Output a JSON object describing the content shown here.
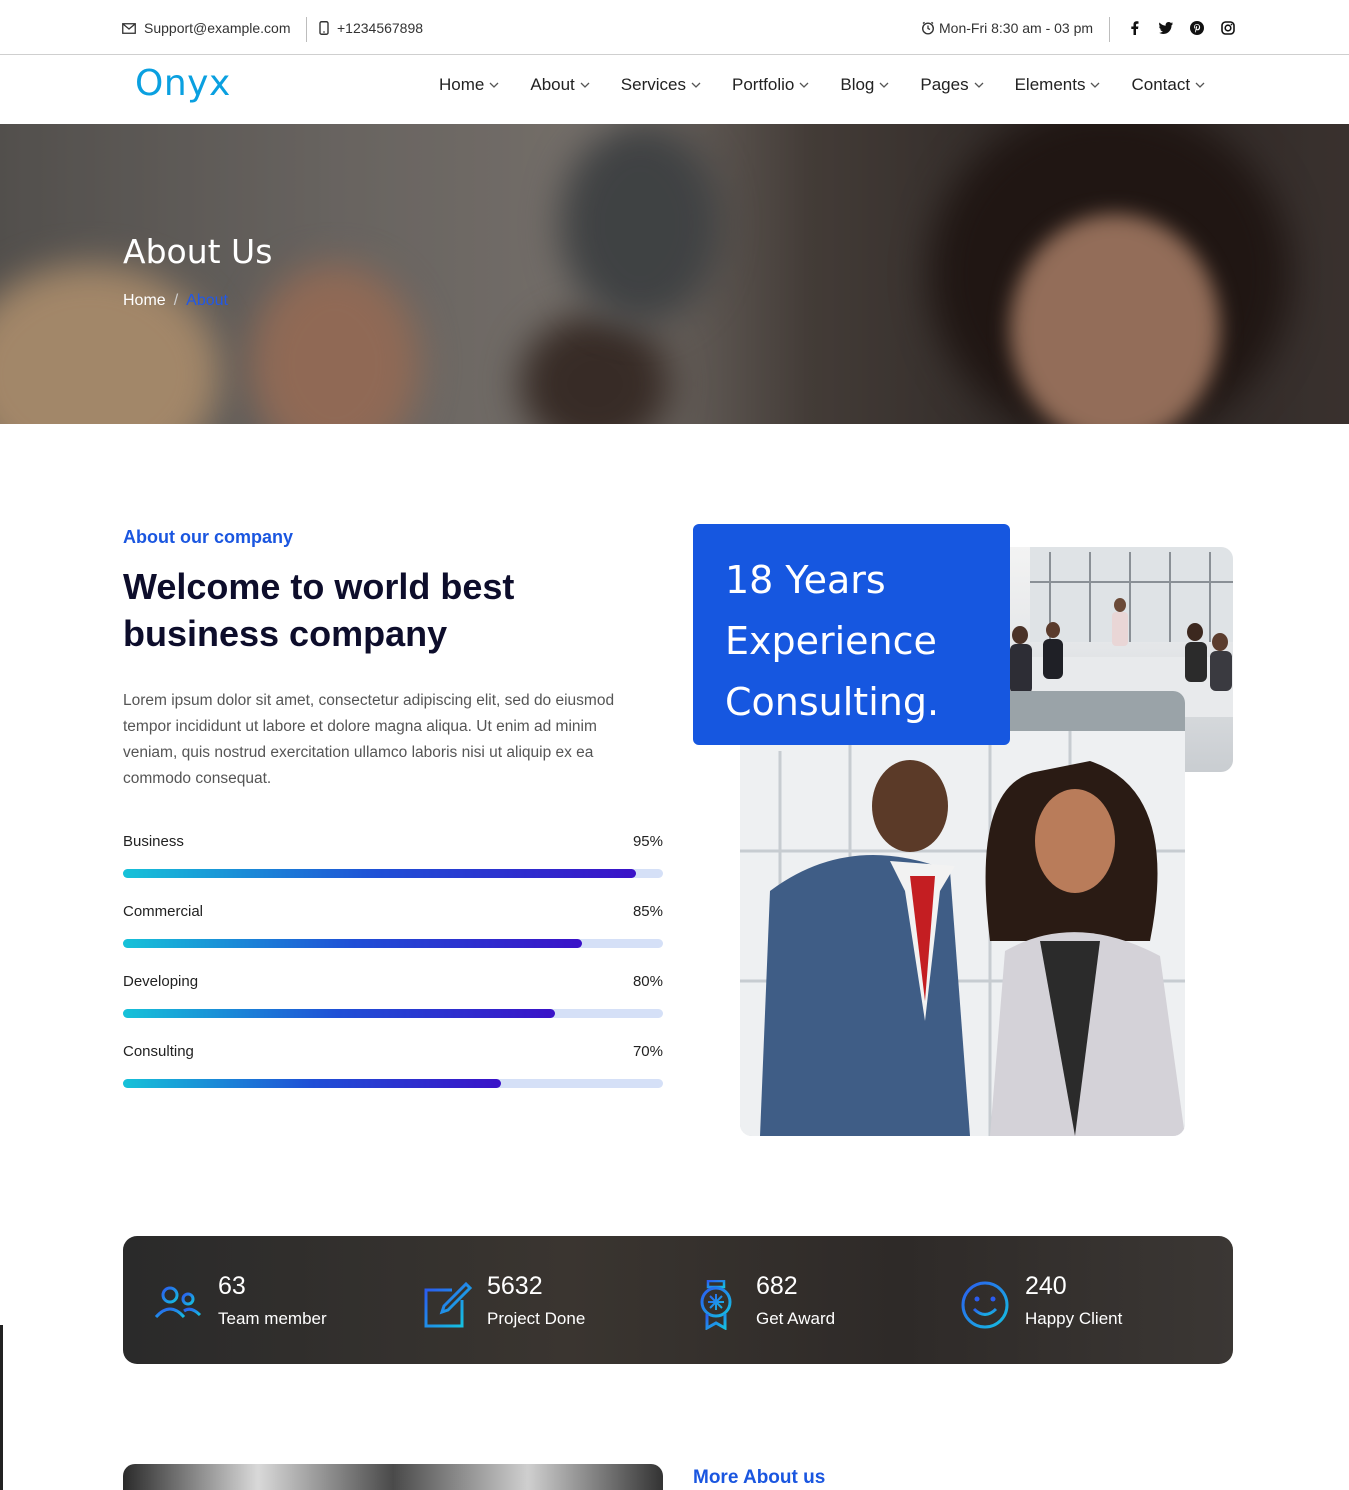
{
  "topbar": {
    "email": "Support@example.com",
    "phone": "+1234567898",
    "hours": "Mon-Fri 8:30 am - 03 pm",
    "social": [
      "facebook-icon",
      "twitter-icon",
      "pinterest-icon",
      "instagram-icon"
    ]
  },
  "header": {
    "logo": "Onyx",
    "nav": [
      "Home",
      "About",
      "Services",
      "Portfolio",
      "Blog",
      "Pages",
      "Elements",
      "Contact"
    ]
  },
  "hero": {
    "title": "About Us",
    "breadcrumb": {
      "home": "Home",
      "separator": "/",
      "current": "About"
    }
  },
  "about": {
    "subheading": "About our company",
    "heading": "Welcome to world best business company",
    "paragraph": "Lorem ipsum dolor sit amet, consectetur adipiscing elit, sed do eiusmod tempor incididunt ut labore et dolore magna aliqua. Ut enim ad minim veniam, quis nostrud exercitation ullamco laboris nisi ut aliquip ex ea commodo consequat.",
    "skills": [
      {
        "label": "Business",
        "percent_text": "95%",
        "value": 95
      },
      {
        "label": "Commercial",
        "percent_text": "85%",
        "value": 85
      },
      {
        "label": "Developing",
        "percent_text": "80%",
        "value": 80
      },
      {
        "label": "Consulting",
        "percent_text": "70%",
        "value": 70
      }
    ],
    "experience": {
      "line1": "18 Years",
      "line2": "Experience",
      "line3": "Consulting."
    }
  },
  "stats": [
    {
      "icon": "team-icon",
      "number": "63",
      "label": "Team member"
    },
    {
      "icon": "edit-icon",
      "number": "5632",
      "label": "Project Done"
    },
    {
      "icon": "award-icon",
      "number": "682",
      "label": "Get Award"
    },
    {
      "icon": "smile-icon",
      "number": "240",
      "label": "Happy Client"
    }
  ],
  "more": {
    "heading": "More About us"
  },
  "colors": {
    "accent": "#1657e0",
    "logo": "#0aa0e0",
    "heading": "#0d0d2b"
  }
}
